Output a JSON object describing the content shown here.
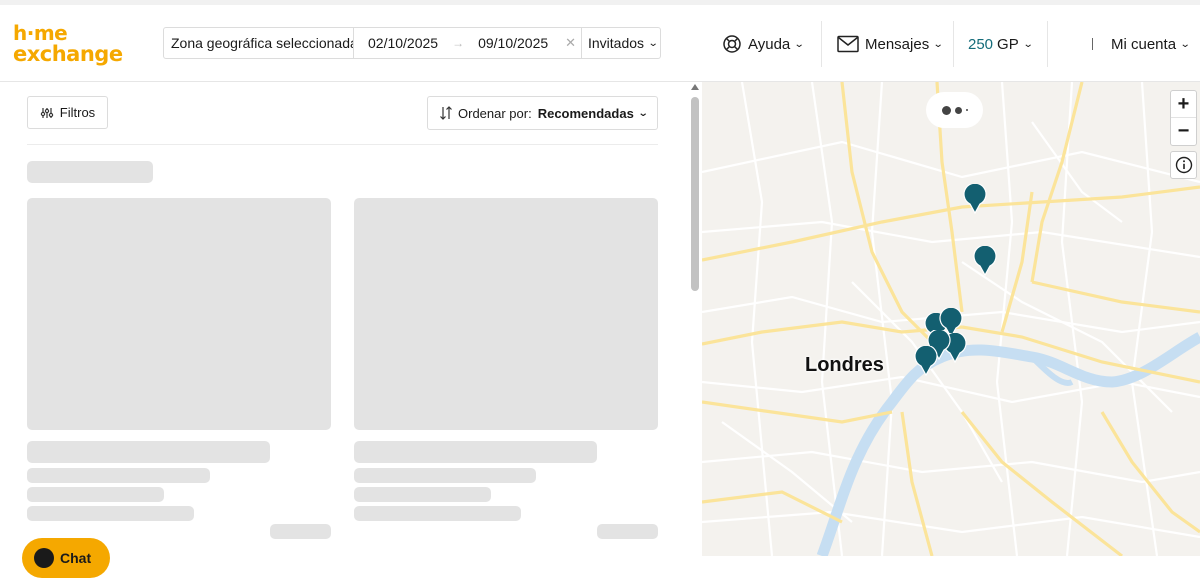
{
  "brand": {
    "logo_line1": "h·me",
    "logo_line2": "exchange",
    "color": "#f5a800"
  },
  "search": {
    "zone": "Zona geográfica seleccionada",
    "date_start": "02/10/2025",
    "date_end": "09/10/2025",
    "guests": "Invitados"
  },
  "nav": {
    "help": "Ayuda",
    "messages": "Mensajes",
    "gp_amount": "250",
    "gp_unit": "GP",
    "account": "Mi cuenta"
  },
  "list": {
    "filters_label": "Filtros",
    "sort_label": "Ordenar por:",
    "sort_value": "Recomendadas"
  },
  "map": {
    "city_label": "Londres",
    "pin_color": "#135f70",
    "water_color": "#c6def2",
    "road_color": "#fbe49a"
  },
  "chat": {
    "label": "Chat"
  },
  "icons": [
    "lifebuoy-icon",
    "mail-icon",
    "chevron-down-icon",
    "filter-sliders-icon",
    "sort-icon",
    "zoom-in-icon",
    "zoom-out-icon",
    "info-icon",
    "map-pin-icon",
    "clear-icon"
  ]
}
